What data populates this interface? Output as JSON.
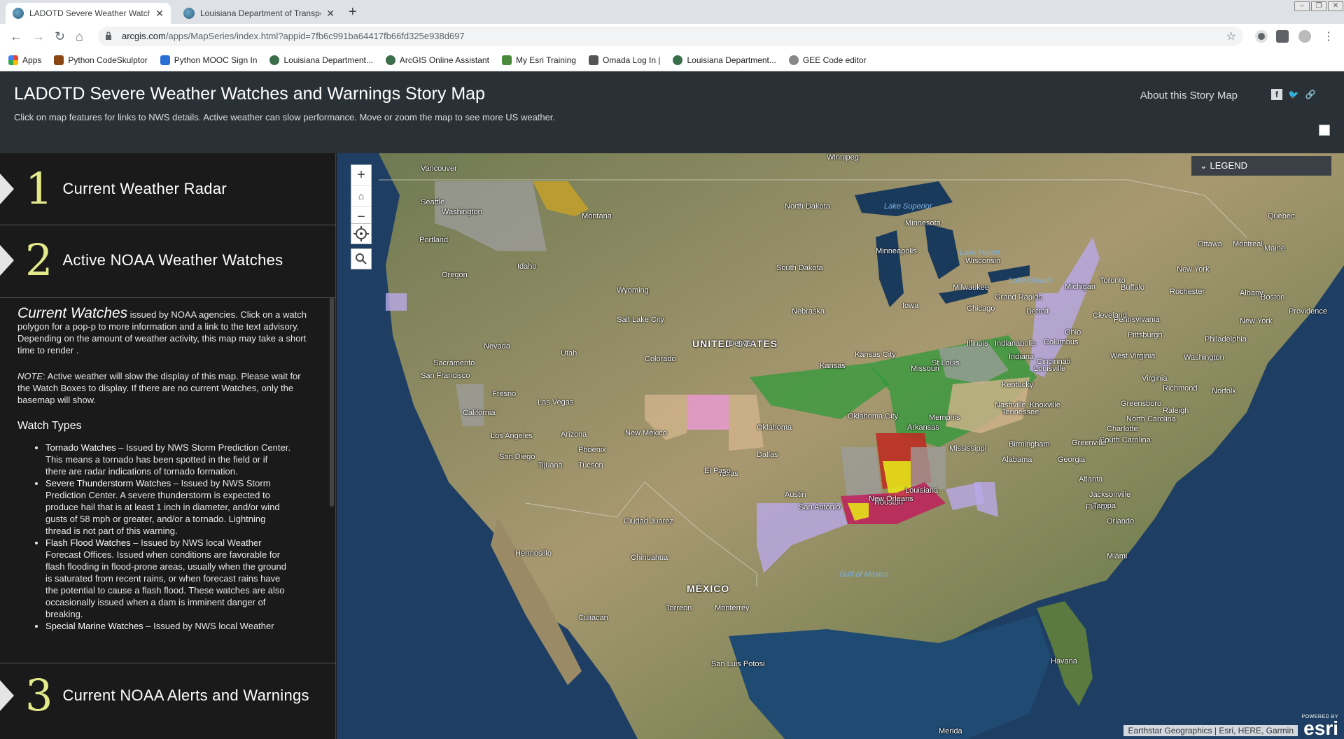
{
  "browser": {
    "tabs": [
      {
        "title": "LADOTD Severe Weather Watches a",
        "active": true
      },
      {
        "title": "Louisiana Department of Transportat",
        "active": false
      }
    ],
    "url_host": "arcgis.com",
    "url_path": "/apps/MapSeries/index.html?appid=7fb6c991ba64417fb66fd325e938d697",
    "bookmarks": [
      "Apps",
      "Python CodeSkulptor",
      "Python MOOC Sign In",
      "Louisiana Department...",
      "ArcGIS Online Assistant",
      "My Esri Training",
      "Omada Log In |",
      "Louisiana Department...",
      "GEE Code editor"
    ]
  },
  "header": {
    "title": "LADOTD Severe Weather Watches and Warnings Story Map",
    "subtitle": "Click on map features for links to NWS details. Active weather can slow performance. Move or zoom the map to see more US weather.",
    "about": "About this Story Map"
  },
  "sections": [
    {
      "num": "1",
      "title": "Current Weather Radar"
    },
    {
      "num": "2",
      "title": "Active NOAA Weather Watches"
    },
    {
      "num": "3",
      "title": "Current NOAA Alerts and Warnings"
    }
  ],
  "content": {
    "lead_em": "Current Watches",
    "lead_text": " issued by NOAA agencies. Click on a watch polygon for a pop-p to more information and a link to the text advisory. Depending on the amount of weather activity, this map may take a short time to render .",
    "note_em": "NOTE",
    "note_text": ": Active weather will slow the display of this map. Please wait for the Watch Boxes to display. If there are no current Watches, only the basemap will show.",
    "watch_types_heading": "Watch Types",
    "watch_types": [
      {
        "name": "Tornado Watches",
        "desc": " – Issued by NWS Storm Prediction Center. This means a tornado has been spotted in the field or if there are radar indications of tornado formation."
      },
      {
        "name": "Severe Thunderstorm Watches",
        "desc": " – Issued by NWS Storm Prediction Center. A severe thunderstorm is expected to produce hail that is at least 1 inch in diameter, and/or wind gusts of 58 mph or greater, and/or a tornado. Lightning thread is not part of this warning."
      },
      {
        "name": "Flash Flood Watches",
        "desc": " – Issued by NWS local Weather Forecast Offices. Issued when conditions are favorable for flash flooding in flood-prone areas, usually when the ground is saturated from recent rains, or when forecast rains have the potential to cause a flash flood. These watches are also occasionally issued when a dam is imminent danger of breaking."
      },
      {
        "name": "Special Marine Watches",
        "desc": " – Issued by NWS local Weather"
      }
    ]
  },
  "map": {
    "legend": "LEGEND",
    "attribution": "Earthstar Geographics | Esri, HERE, Garmin",
    "esri_small": "POWERED BY",
    "esri_big": "esri",
    "country_labels": [
      "UNITED STATES",
      "MÉXICO"
    ],
    "state_labels": [
      "Washington",
      "Oregon",
      "Idaho",
      "Montana",
      "Wyoming",
      "Nevada",
      "Utah",
      "Colorado",
      "California",
      "Arizona",
      "New Mexico",
      "Texas",
      "Oklahoma",
      "Kansas",
      "Nebraska",
      "South Dakota",
      "North Dakota",
      "Minnesota",
      "Iowa",
      "Missouri",
      "Arkansas",
      "Louisiana",
      "Mississippi",
      "Alabama",
      "Georgia",
      "Florida",
      "Tennessee",
      "Kentucky",
      "Illinois",
      "Indiana",
      "Ohio",
      "Michigan",
      "Wisconsin",
      "Pennsylvania",
      "New York",
      "Virginia",
      "North Carolina",
      "South Carolina",
      "West Virginia",
      "Maine",
      "Quebec"
    ],
    "city_labels": [
      "Vancouver",
      "Seattle",
      "Portland",
      "Winnipeg",
      "Sacramento",
      "San Francisco",
      "Fresno",
      "Los Angeles",
      "San Diego",
      "Tijuana",
      "Las Vegas",
      "Phoenix",
      "Tucson",
      "Salt Lake City",
      "Denver",
      "El Paso",
      "Dallas",
      "Austin",
      "San Antonio",
      "Houston",
      "New Orleans",
      "Oklahoma City",
      "Kansas City",
      "St Louis",
      "Memphis",
      "Nashville",
      "Birmingham",
      "Atlanta",
      "Jacksonville",
      "Orlando",
      "Tampa",
      "Miami",
      "Chicago",
      "Milwaukee",
      "Minneapolis",
      "Detroit",
      "Cleveland",
      "Columbus",
      "Cincinnati",
      "Indianapolis",
      "Louisville",
      "Knoxville",
      "Pittsburgh",
      "Washington",
      "Philadelphia",
      "New York",
      "Boston",
      "Providence",
      "Albany",
      "Rochester",
      "Buffalo",
      "Toronto",
      "Ottawa",
      "Montreal",
      "Charlotte",
      "Greensboro",
      "Raleigh",
      "Richmond",
      "Norfolk",
      "Greenville",
      "Grand Rapids",
      "Hermosillo",
      "Chihuahua",
      "Monterrey",
      "Torreon",
      "Culiacan",
      "San Luis Potosi",
      "Havana",
      "Merida",
      "Ciudad Juarez"
    ],
    "water_labels": [
      "Lake Superior",
      "Lake Huron",
      "Lake Ontario",
      "Gulf of Mexico"
    ],
    "colors": {
      "tornado": "#c0281e",
      "severe_thunderstorm": "#e4e21a",
      "flash_flood": "#2f9a3a",
      "special_marine": "#b9a9e8",
      "fire_weather": "#e5a6c8",
      "gray_watch": "#9e9e9e",
      "tan_watch": "#d2b48c",
      "ocean": "#1e3f63",
      "land": "#8a8a5a"
    }
  }
}
